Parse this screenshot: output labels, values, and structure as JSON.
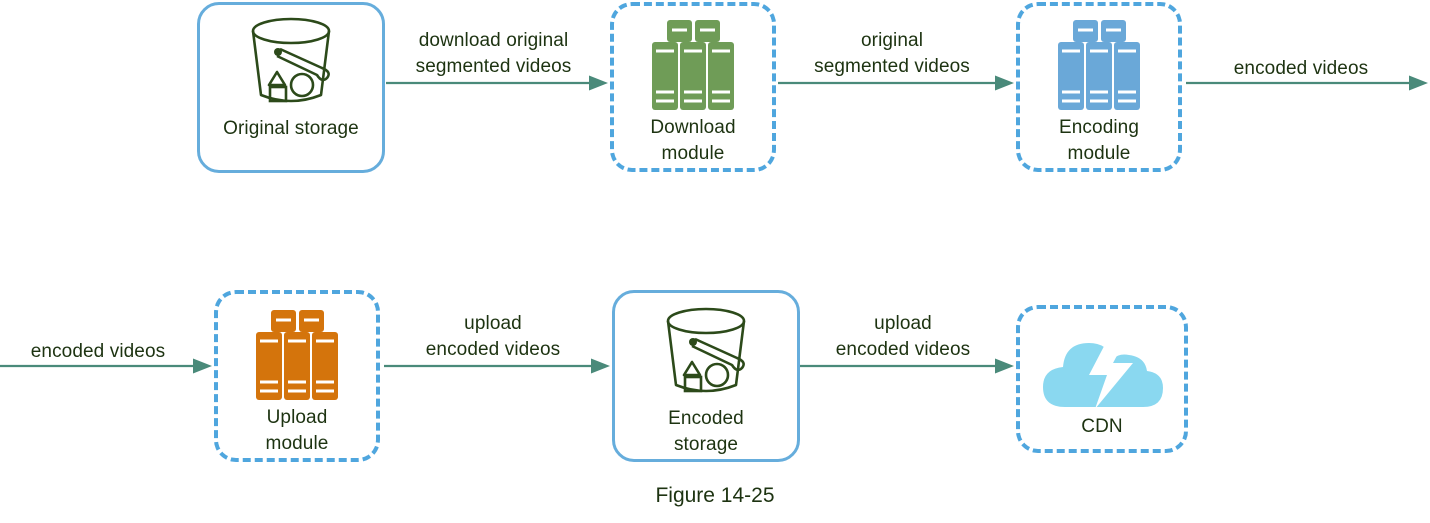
{
  "figure": {
    "caption": "Figure 14-25",
    "background_color": "#ffffff"
  },
  "colors": {
    "solid_box_border": "#66ADDC",
    "dashed_box_border": "#4FA6DE",
    "arrow": "#4a8a7a",
    "text": "#1d3311",
    "bucket_outline": "#2c4a1a",
    "server_green": "#6f9c57",
    "server_blue": "#6aa8d8",
    "server_orange": "#d4740c",
    "cloud_blue": "#8ad8f0"
  },
  "nodes": [
    {
      "id": "original-storage",
      "label": "Original storage",
      "icon": "bucket-icon",
      "style": "solid",
      "icon_color": "#2c4a1a"
    },
    {
      "id": "download-module",
      "label": "Download\nmodule",
      "icon": "server-rack-icon",
      "style": "dashed",
      "icon_color": "#6f9c57"
    },
    {
      "id": "encoding-module",
      "label": "Encoding\nmodule",
      "icon": "server-rack-icon",
      "style": "dashed",
      "icon_color": "#6aa8d8"
    },
    {
      "id": "upload-module",
      "label": "Upload\nmodule",
      "icon": "server-rack-icon",
      "style": "dashed",
      "icon_color": "#d4740c"
    },
    {
      "id": "encoded-storage",
      "label": "Encoded\nstorage",
      "icon": "bucket-icon",
      "style": "solid",
      "icon_color": "#2c4a1a"
    },
    {
      "id": "cdn",
      "label": "CDN",
      "icon": "cloud-lightning-icon",
      "style": "dashed",
      "icon_color": "#8ad8f0"
    }
  ],
  "edges": [
    {
      "id": "edge-download",
      "label": "download original\nsegmented videos",
      "from": "original-storage",
      "to": "download-module"
    },
    {
      "id": "edge-original-segmented",
      "label": "original\nsegmented videos",
      "from": "download-module",
      "to": "encoding-module"
    },
    {
      "id": "edge-encoded-out",
      "label": "encoded videos",
      "from": "encoding-module",
      "to": ""
    },
    {
      "id": "edge-encoded-in",
      "label": "encoded videos",
      "from": "",
      "to": "upload-module"
    },
    {
      "id": "edge-upload-storage",
      "label": "upload\nencoded videos",
      "from": "upload-module",
      "to": "encoded-storage"
    },
    {
      "id": "edge-upload-cdn",
      "label": "upload\nencoded videos",
      "from": "encoded-storage",
      "to": "cdn"
    }
  ]
}
